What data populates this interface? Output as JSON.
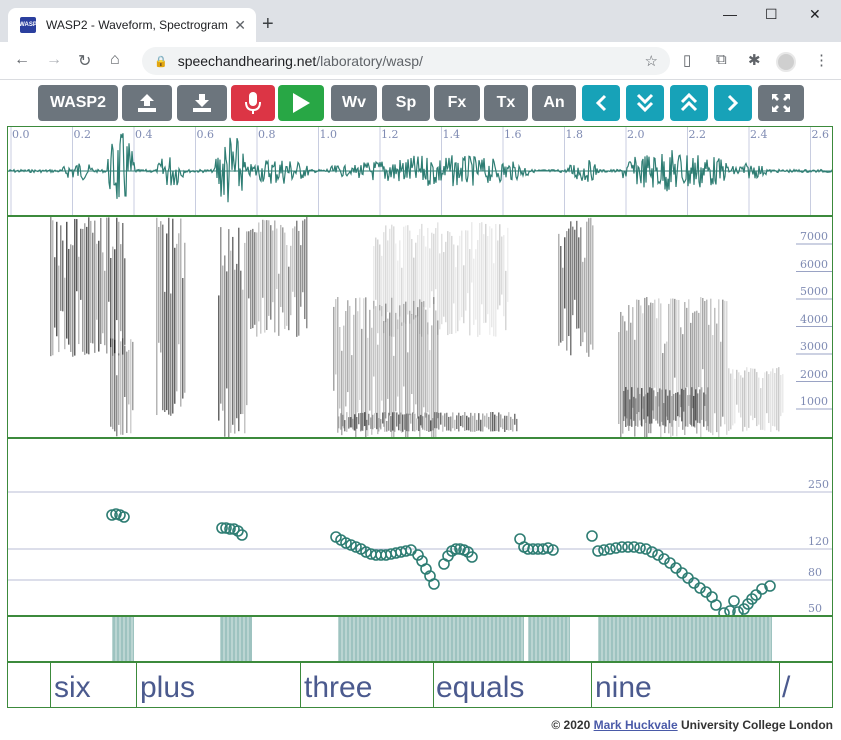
{
  "browser": {
    "tab_title": "WASP2 - Waveform, Spectrogram",
    "url_host": "speechandhearing.net",
    "url_path": "/laboratory/wasp/",
    "favicon_text": "WASP"
  },
  "toolbar": {
    "wasp_label": "WASP2",
    "wv_label": "Wv",
    "sp_label": "Sp",
    "fx_label": "Fx",
    "tx_label": "Tx",
    "an_label": "An"
  },
  "colors": {
    "waveform": "#2e7d73",
    "panel_border": "#3c8a3c",
    "tick": "#7f8bb3",
    "label": "#4b5a8e"
  },
  "waveform": {
    "time_ticks": [
      "0.0",
      "0.2",
      "0.4",
      "0.6",
      "0.8",
      "1.0",
      "1.2",
      "1.4",
      "1.6",
      "1.8",
      "2.0",
      "2.2",
      "2.4",
      "2.6"
    ]
  },
  "spectrogram": {
    "freq_ticks": [
      "7000",
      "6000",
      "5000",
      "4000",
      "3000",
      "2000",
      "1000"
    ]
  },
  "pitch": {
    "scale_ticks": [
      "250",
      "120",
      "80",
      "50"
    ]
  },
  "annotation": {
    "labels": [
      "six",
      "plus",
      "three",
      "equals",
      "nine",
      "/"
    ]
  },
  "footer": {
    "copyright": "© 2020",
    "author": "Mark Huckvale",
    "org": "University College London"
  }
}
